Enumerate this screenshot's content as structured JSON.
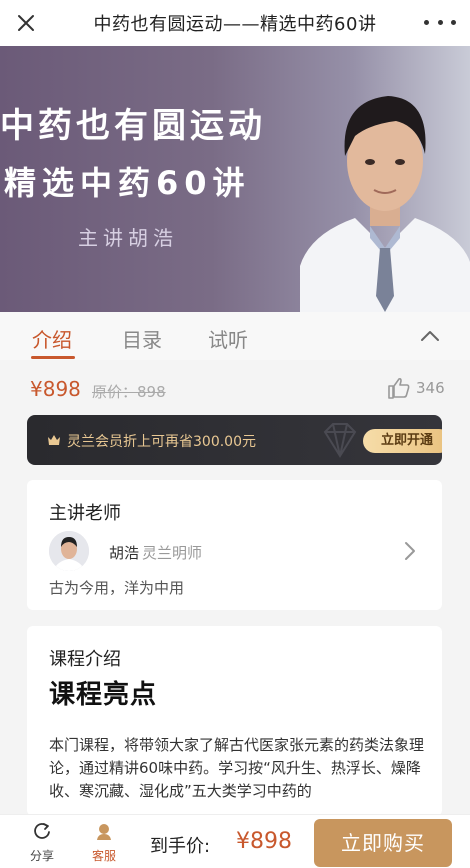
{
  "header": {
    "title": "中药也有圆运动——精选中药60讲",
    "close_icon": "close-icon",
    "more_icon": "more-icon"
  },
  "banner": {
    "line1": "中药也有圆运动",
    "line2": "精选中药60讲",
    "line3": "主讲胡浩"
  },
  "tabs": {
    "items": [
      "介绍",
      "目录",
      "试听"
    ],
    "active": "介绍"
  },
  "pricing": {
    "price": "¥898",
    "original": "原价：898",
    "likes": "346"
  },
  "vip": {
    "text": "灵兰会员折上可再省300.00元",
    "button": "立即开通",
    "accent": "#e9c893"
  },
  "teacher_card": {
    "heading": "主讲老师",
    "name": "胡浩",
    "role": "灵兰明师",
    "motto": "古为今用，洋为中用"
  },
  "intro_card": {
    "heading": "课程介绍",
    "title": "课程亮点",
    "paragraph": "本门课程，将带领大家了解古代医家张元素的药类法象理论，通过精讲60味中药。学习按“风升生、热浮长、燥降收、寒沉藏、湿化成”五大类学习中药的"
  },
  "bottom": {
    "share": "分享",
    "service": "客服",
    "final_label": "到手价:",
    "final_price": "¥898",
    "buy_button": "立即购买",
    "accent": "#c8582d",
    "buy_color": "#c8965e"
  }
}
